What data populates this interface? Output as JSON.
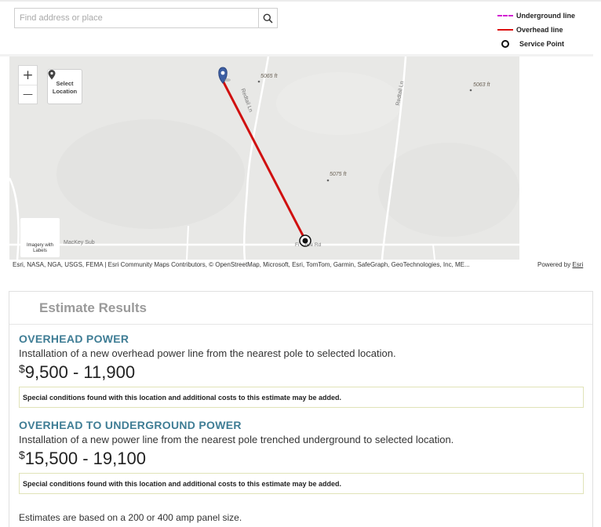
{
  "search": {
    "placeholder": "Find address or place",
    "button_icon": "search-icon"
  },
  "legend": {
    "items": [
      {
        "label": "Underground line",
        "color": "#d21fd2",
        "style": "dashed"
      },
      {
        "label": "Overhead line",
        "color": "#dd1111",
        "style": "solid"
      },
      {
        "label": "Service Point",
        "color": "#111111",
        "style": "circle"
      }
    ]
  },
  "map": {
    "zoom_in": "+",
    "zoom_out": "—",
    "select_location": "Select Location",
    "basemap_label": "Imagery with Labels",
    "labels": {
      "elev_5065": "5065 ft",
      "elev_5063": "5063 ft",
      "elev_5075": "5075 ft",
      "redtail_1": "Redtail Ln",
      "redtail_2": "Redtail Ln",
      "mackey": "MacKey Sub",
      "road": "Fi    ove Rd"
    },
    "attribution": "Esri, NASA, NGA, USGS, FEMA | Esri Community Maps Contributors, © OpenStreetMap, Microsoft, Esri, TomTom, Garmin, SafeGraph, GeoTechnologies, Inc, ME...",
    "powered_by": "Powered by",
    "powered_by_link": "Esri"
  },
  "results": {
    "title": "Estimate Results",
    "overhead": {
      "title": "OVERHEAD POWER",
      "description": "Installation of a new overhead power line from the nearest pole to selected location.",
      "currency": "$",
      "range": "9,500 - 11,900",
      "notice": "Special conditions found with this location and additional costs to this estimate may be added."
    },
    "underground": {
      "title": "OVERHEAD TO UNDERGROUND POWER",
      "description": "Installation of a new power line from the nearest pole trenched underground to selected location.",
      "currency": "$",
      "range": "15,500 - 19,100",
      "notice": "Special conditions found with this location and additional costs to this estimate may be added."
    },
    "footnote": "Estimates are based on a 200 or 400 amp panel size."
  }
}
